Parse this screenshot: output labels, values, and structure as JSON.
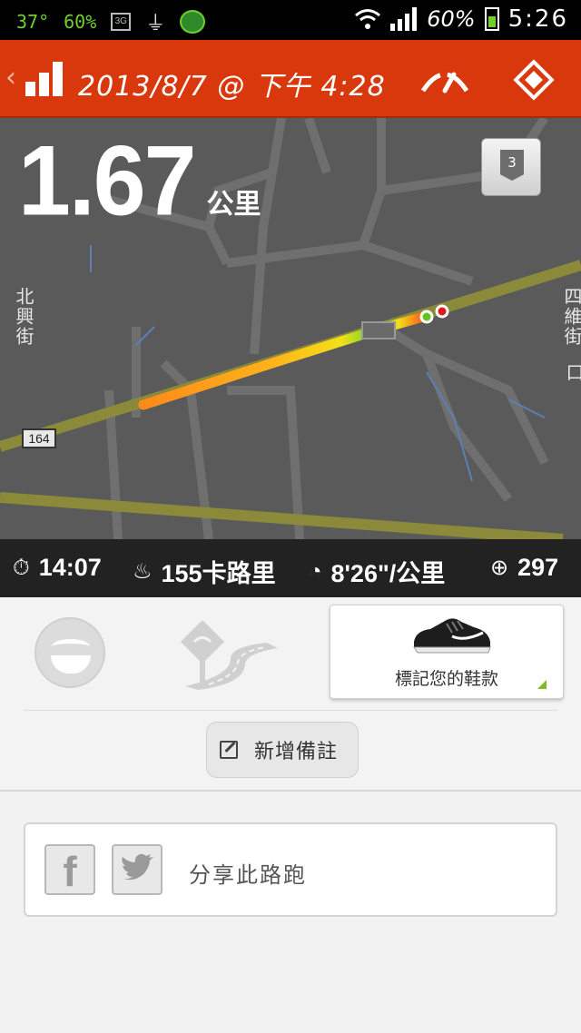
{
  "status_bar": {
    "temp": "37°",
    "battery_small": "60%",
    "network_badge": "3G",
    "battery_percent": "60%",
    "time": "5:26"
  },
  "header": {
    "title": "2013/8/7 @ 下午 4:28",
    "accent_color": "#d8380c"
  },
  "map": {
    "distance_value": "1.67",
    "distance_unit": "公里",
    "lap_count": "3",
    "road_shield": "164",
    "street_left": "北興街",
    "street_right": "四維街",
    "street_right_suffix": "口"
  },
  "stats": {
    "duration": "14:07",
    "calories": "155卡路里",
    "pace": "8'26\"/公里",
    "fuel": "297"
  },
  "actions": {
    "shoe_label": "標記您的鞋款",
    "add_note_label": "新增備註"
  },
  "share": {
    "label": "分享此路跑",
    "facebook_glyph": "f"
  }
}
